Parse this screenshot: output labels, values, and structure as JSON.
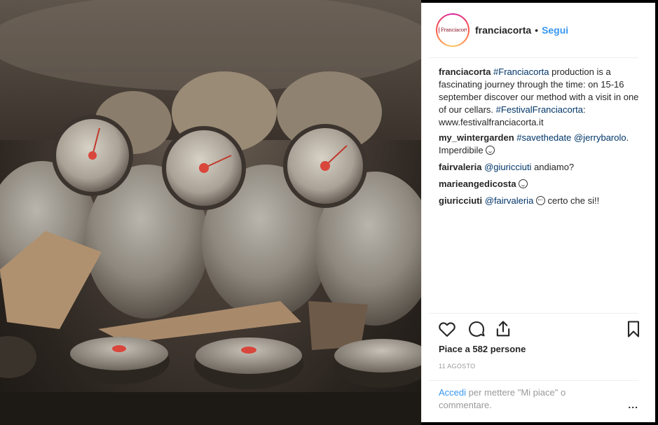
{
  "post": {
    "photo_alt": "",
    "author": "franciacorta",
    "separator": "•",
    "follow_label": "Segui",
    "avatar_text": "Franciacorta"
  },
  "caption": {
    "user": "franciacorta",
    "hashtag1": "#Franciacorta",
    "text1": " production is a fascinating journey through the time: on 15-16 september discover our method with a visit in one of our cellars. ",
    "hashtag2": "#FestivalFranciacorta",
    "text2": ": www.festivalfranciacorta.it"
  },
  "comments": [
    {
      "user": "my_wintergarden",
      "tag": "#savethedate",
      "mention": "@jerrybarolo",
      "text": ". Imperdibile",
      "emoji": "smile-emoji"
    },
    {
      "user": "fairvaleria",
      "mention": "@giuricciuti",
      "text": " andiamo?"
    },
    {
      "user": "marieangedicosta",
      "emoji": "smile-emoji"
    },
    {
      "user": "giuricciuti",
      "mention": "@fairvaleria",
      "text": " certo che si!!",
      "emoji": "heart-eyes-emoji"
    }
  ],
  "actions": {
    "like_icon": "heart-icon",
    "comment_icon": "comment-icon",
    "share_icon": "share-icon",
    "save_icon": "bookmark-icon"
  },
  "likes_text": "Piace a 582 persone",
  "date_text": "11 AGOSTO",
  "footer": {
    "login_label": "Accedi",
    "prompt": " per mettere \"Mi piace\" o commentare.",
    "more_label": "..."
  },
  "colors": {
    "link": "#3897f0",
    "mention": "#003569",
    "text": "#262626",
    "muted": "#999999"
  }
}
